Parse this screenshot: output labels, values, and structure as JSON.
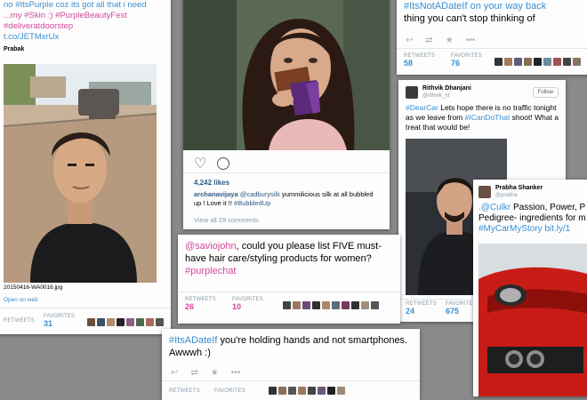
{
  "card1": {
    "lines": [
      "no #ItsPurple coz its got all that i need",
      "...my #Skin :) #PurpleBeautyFest",
      "#deliveratdoorstep",
      "t.co/JETMxrUx"
    ],
    "username": "Prabak",
    "filename": "20150416-WA0016.jpg",
    "open_web": "Open on web",
    "retweets_label": "RETWEETS",
    "favorites_label": "FAVORITES",
    "retweets": "",
    "favorites": "31"
  },
  "card2": {
    "likes": "4,242 likes",
    "caption_user": "archanavijaya",
    "caption_mention": "@cadburysilk",
    "caption_text": "yummilicious silk at all bubbled up ! Love it !!",
    "caption_tag": "#BubbledUp",
    "view_comments": "View all 29 comments"
  },
  "card3": {
    "lines": [
      "#ItsNotADateIf on your way back",
      "thing you can't stop thinking of"
    ],
    "retweets_label": "RETWEETS",
    "favorites_label": "FAVORITES",
    "retweets": "58",
    "favorites": "76"
  },
  "card4": {
    "name": "Rithvik Dhanjani",
    "handle": "@rithvik_rd",
    "follow": "Follow",
    "text_tag": "#DearCar",
    "text_body": "Lets hope there is no traffic tonight as we leave from",
    "text_tag2": "#ICanDoThat",
    "text_end": "shoot! What a treat that would be!",
    "retweets_label": "RETWEETS",
    "favorites_label": "FAVORITES",
    "retweets": "24",
    "favorites": "675"
  },
  "card5": {
    "mention": "@saviojohn",
    "text": ", could you please list FIVE must-have hair care/styling products for women?",
    "tag": "#purplechat",
    "retweets_label": "RETWEETS",
    "favorites_label": "FAVORITES",
    "retweets": "26",
    "favorites": "10"
  },
  "card6": {
    "name": "Prabha Shanker",
    "handle": "@prabha",
    "text_tag": ".@Culkr",
    "text_body": "Passion, Power, P Pedigree- ingredients for m",
    "text_tags": "#MyCarMyStory bit.ly/1"
  },
  "card7": {
    "tag": "#ItsADateIf",
    "text": "you're holding hands and not smartphones. Awwwh :)",
    "retweets_label": "RETWEETS",
    "favorites_label": "FAVORITES"
  },
  "colors": {
    "twitter_blue": "#3a8fd1",
    "hashtag_pink": "#d2479b",
    "car_red": "#c81c16"
  }
}
